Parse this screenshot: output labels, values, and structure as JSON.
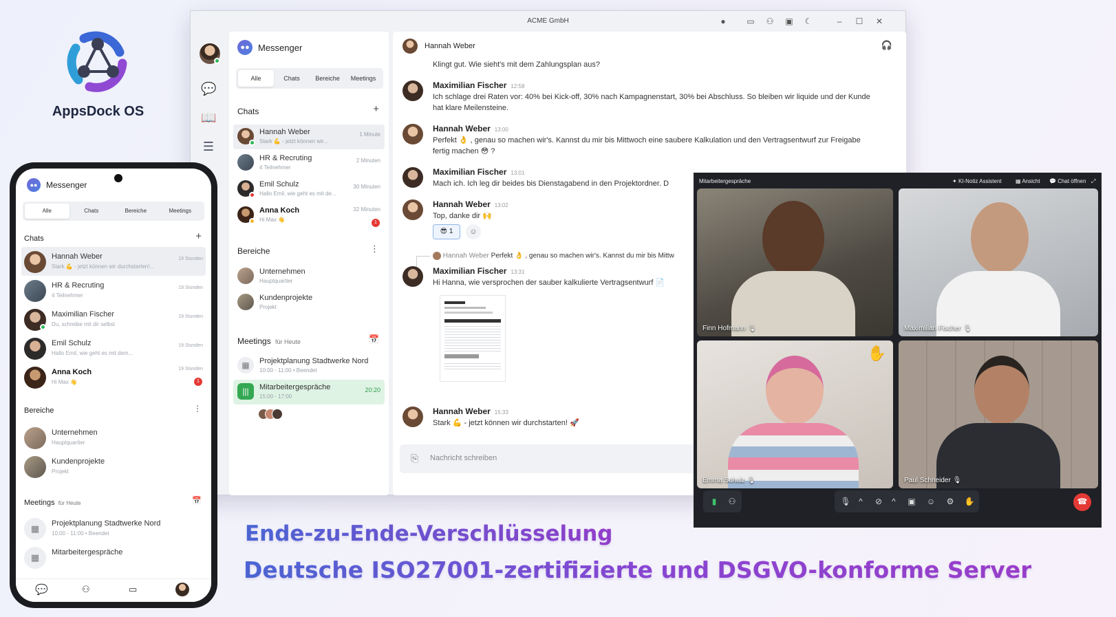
{
  "brand": {
    "name": "AppsDock OS"
  },
  "window": {
    "title": "ACME GmbH"
  },
  "messenger": {
    "title": "Messenger",
    "tabs": [
      "Alle",
      "Chats",
      "Bereiche",
      "Meetings"
    ],
    "chats_title": "Chats",
    "chats": [
      {
        "name": "Hannah Weber",
        "preview": "Stark 💪 - jetzt können wir...",
        "time": "1 Minute",
        "bold": false
      },
      {
        "name": "HR & Recruting",
        "preview": "4 Teilnehmer",
        "time": "2 Minuten",
        "bold": false
      },
      {
        "name": "Emil Schulz",
        "preview": "Hallo Emil, wie geht es mit de...",
        "time": "30 Minuten",
        "bold": false
      },
      {
        "name": "Anna Koch",
        "preview": "Hi Max 👋",
        "time": "32 Minuten",
        "bold": true,
        "badge": "1"
      }
    ],
    "areas_title": "Bereiche",
    "areas": [
      {
        "name": "Unternehmen",
        "sub": "Hauptquartier"
      },
      {
        "name": "Kundenprojekte",
        "sub": "Projekt"
      }
    ],
    "meetings_title": "Meetings",
    "meetings_sub": "für Heute",
    "meetings": [
      {
        "name": "Projektplanung Stadtwerke Nord",
        "sub": "10:00 - 11:00 • Beendet",
        "time": ""
      },
      {
        "name": "Mitarbeitergespräche",
        "sub": "15:00 - 17:00",
        "time": "20:20"
      }
    ]
  },
  "chat": {
    "partner": "Hannah Weber",
    "messages": [
      {
        "author": "",
        "time": "",
        "text": "Klingt gut. Wie sieht's mit dem Zahlungsplan aus?"
      },
      {
        "author": "Maximilian Fischer",
        "time": "12:58",
        "text": "Ich schlage drei Raten vor: 40% bei Kick-off, 30% nach Kampagnenstart, 30% bei Abschluss. So bleiben wir liquide und der Kunde hat klare Meilensteine."
      },
      {
        "author": "Hannah Weber",
        "time": "13:00",
        "text": "Perfekt 👌 , genau so machen wir's. Kannst du mir bis Mittwoch eine saubere Kalkulation und den Vertragsentwurf zur Freigabe fertig machen 😳 ?"
      },
      {
        "author": "Maximilian Fischer",
        "time": "13:01",
        "text": "Mach ich. Ich leg dir beides bis Dienstagabend in den Projektordner. D"
      },
      {
        "author": "Hannah Weber",
        "time": "13:02",
        "text": "Top, danke dir 🙌"
      },
      {
        "author": "Maximilian Fischer",
        "time": "13:31",
        "text": "Hi Hanna, wie versprochen der sauber kalkulierte Vertragsentwurf 📄"
      },
      {
        "author": "Hannah Weber",
        "time": "15:33",
        "text": "Stark 💪 - jetzt können wir durchstarten! 🚀"
      }
    ],
    "reaction": {
      "emoji": "😎",
      "count": "1"
    },
    "quote": {
      "author": "Hannah Weber",
      "text": "Perfekt 👌 , genau so machen wir's. Kannst du mir bis Mittw"
    },
    "input_placeholder": "Nachricht schreiben"
  },
  "video": {
    "title": "Mitarbeitergespräche",
    "actions": [
      "KI-Notiz Assistent",
      "Ansicht",
      "Chat öffnen"
    ],
    "participants": [
      "Finn Hofmann",
      "Maximilian Fischer",
      "Emma Schulz",
      "Paul Schneider"
    ]
  },
  "phone": {
    "title": "Messenger",
    "tabs": [
      "Alle",
      "Chats",
      "Bereiche",
      "Meetings"
    ],
    "chats_title": "Chats",
    "chats": [
      {
        "name": "Hannah Weber",
        "preview": "Stark 💪 - jetzt können wir durchstarten!...",
        "time": "19 Stunden",
        "bold": false
      },
      {
        "name": "HR & Recruting",
        "preview": "4 Teilnehmer",
        "time": "19 Stunden",
        "bold": false
      },
      {
        "name": "Maximilian Fischer",
        "preview": "Du, schreibe mit dir selbst",
        "time": "19 Stunden",
        "bold": false
      },
      {
        "name": "Emil Schulz",
        "preview": "Hallo Emil, wie geht es mit dem...",
        "time": "19 Stunden",
        "bold": false
      },
      {
        "name": "Anna Koch",
        "preview": "Hi Max 👋",
        "time": "19 Stunden",
        "bold": true,
        "badge": "1"
      }
    ],
    "areas_title": "Bereiche",
    "areas": [
      {
        "name": "Unternehmen",
        "sub": "Hauptquartier"
      },
      {
        "name": "Kundenprojekte",
        "sub": "Projekt"
      }
    ],
    "meetings_title": "Meetings",
    "meetings_sub": "für Heute",
    "meetings": [
      {
        "name": "Projektplanung Stadtwerke Nord",
        "sub": "10:00 - 11:00  •  Beendet"
      },
      {
        "name": "Mitarbeitergespräche",
        "sub": ""
      }
    ]
  },
  "headline1": "Ende-zu-Ende-Verschlüsselung",
  "headline2": "Deutsche ISO27001-zertifizierte und DSGVO-konforme Server"
}
